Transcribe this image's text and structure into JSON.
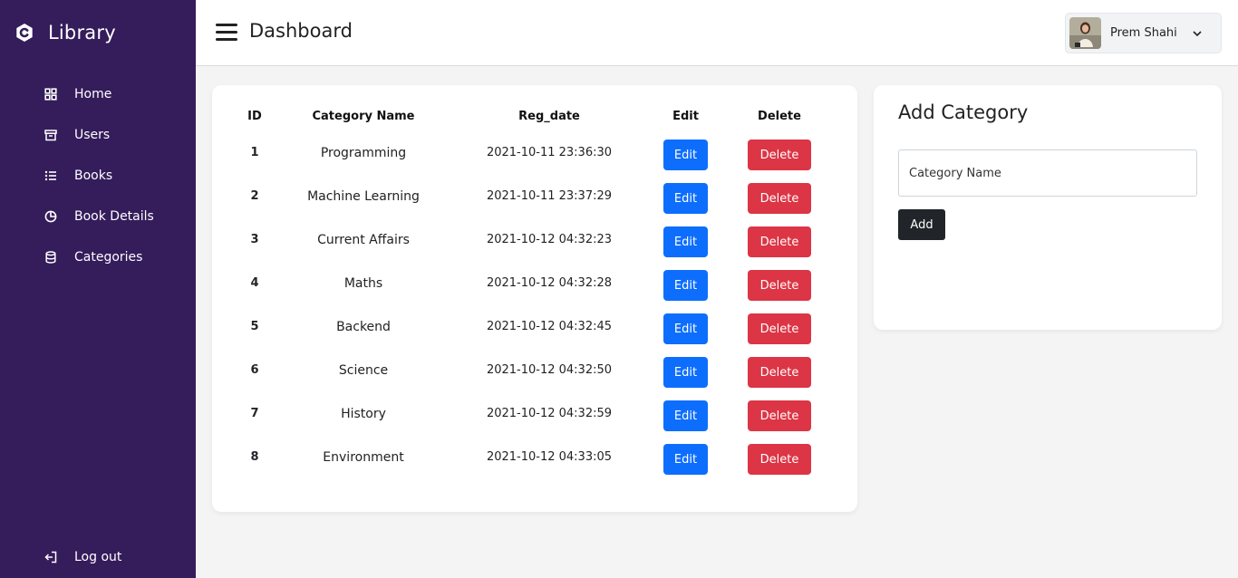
{
  "app": {
    "brand": "Library",
    "page_title": "Dashboard"
  },
  "sidebar": {
    "items": [
      {
        "label": "Home",
        "icon": "grid-icon"
      },
      {
        "label": "Users",
        "icon": "archive-icon"
      },
      {
        "label": "Books",
        "icon": "list-icon"
      },
      {
        "label": "Book Details",
        "icon": "pie-chart-icon"
      },
      {
        "label": "Categories",
        "icon": "database-icon"
      }
    ],
    "logout_label": "Log out"
  },
  "user": {
    "name": "Prem Shahi"
  },
  "table": {
    "headers": {
      "id": "ID",
      "name": "Category Name",
      "date": "Reg_date",
      "edit": "Edit",
      "delete": "Delete"
    },
    "rows": [
      {
        "id": "1",
        "name": "Programming",
        "date": "2021-10-11 23:36:30",
        "edit": "Edit",
        "delete": "Delete"
      },
      {
        "id": "2",
        "name": "Machine Learning",
        "date": "2021-10-11 23:37:29",
        "edit": "Edit",
        "delete": "Delete"
      },
      {
        "id": "3",
        "name": "Current Affairs",
        "date": "2021-10-12 04:32:23",
        "edit": "Edit",
        "delete": "Delete"
      },
      {
        "id": "4",
        "name": "Maths",
        "date": "2021-10-12 04:32:28",
        "edit": "Edit",
        "delete": "Delete"
      },
      {
        "id": "5",
        "name": "Backend",
        "date": "2021-10-12 04:32:45",
        "edit": "Edit",
        "delete": "Delete"
      },
      {
        "id": "6",
        "name": "Science",
        "date": "2021-10-12 04:32:50",
        "edit": "Edit",
        "delete": "Delete"
      },
      {
        "id": "7",
        "name": "History",
        "date": "2021-10-12 04:32:59",
        "edit": "Edit",
        "delete": "Delete"
      },
      {
        "id": "8",
        "name": "Environment",
        "date": "2021-10-12 04:33:05",
        "edit": "Edit",
        "delete": "Delete"
      }
    ]
  },
  "add_category": {
    "title": "Add Category",
    "input_placeholder": "Category Name",
    "input_value": "",
    "button_label": "Add"
  },
  "colors": {
    "sidebar_bg": "#351c5b",
    "edit_button": "#0d6efd",
    "delete_button": "#dc3545",
    "add_button": "#212529"
  }
}
